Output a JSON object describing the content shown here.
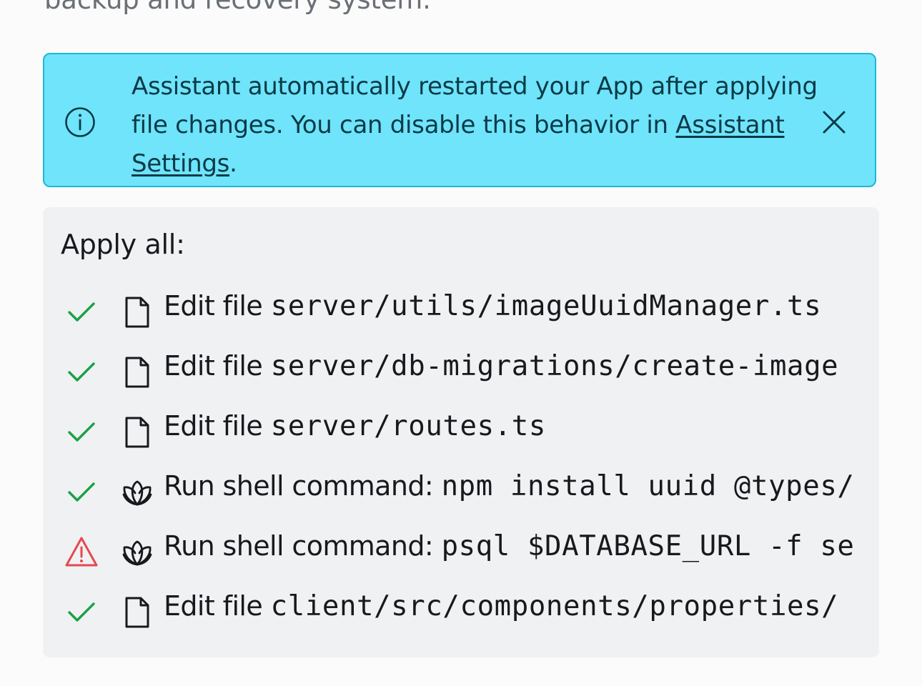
{
  "intro_text": "backup and recovery system.",
  "banner": {
    "message": "Assistant automatically restarted your App after applying file changes. You can disable this behavior in",
    "link_label": "Assistant Settings",
    "suffix": ".",
    "icon": "info-icon",
    "close_icon": "close-icon"
  },
  "panel": {
    "heading": "Apply all:",
    "items": [
      {
        "status": "success",
        "kind": "file",
        "label": "Edit file",
        "target": "server/utils/imageUuidManager.ts"
      },
      {
        "status": "success",
        "kind": "file",
        "label": "Edit file",
        "target": "server/db-migrations/create-image"
      },
      {
        "status": "success",
        "kind": "file",
        "label": "Edit file",
        "target": "server/routes.ts"
      },
      {
        "status": "success",
        "kind": "shell",
        "label": "Run shell command:",
        "target": "npm install uuid @types/"
      },
      {
        "status": "warning",
        "kind": "shell",
        "label": "Run shell command:",
        "target": "psql $DATABASE_URL -f se"
      },
      {
        "status": "success",
        "kind": "file",
        "label": "Edit file",
        "target": "client/src/components/properties/"
      }
    ]
  },
  "colors": {
    "banner_bg": "#6fe4fb",
    "banner_border": "#1fb6d6",
    "success": "#19a045",
    "warning": "#e5484d",
    "panel_bg": "#f0f1f3"
  }
}
